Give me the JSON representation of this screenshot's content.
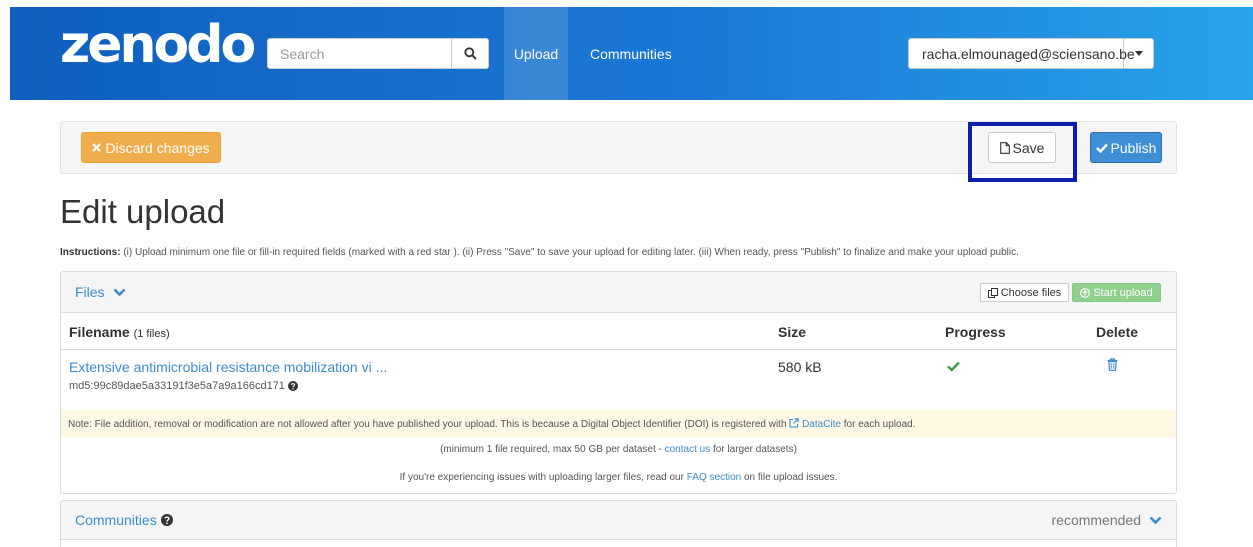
{
  "header": {
    "logo_text": "zenodo",
    "search_placeholder": "Search",
    "nav_upload": "Upload",
    "nav_communities": "Communities",
    "user_email": "racha.elmounaged@sciensano.be"
  },
  "actions": {
    "discard_label": "Discard changes",
    "save_label": "Save",
    "publish_label": "Publish"
  },
  "page": {
    "title": "Edit upload",
    "instructions_label": "Instructions:",
    "instructions_text": " (i) Upload minimum one file or fill-in required fields (marked with a red star ). (ii) Press \"Save\" to save your upload for editing later. (iii) When ready, press \"Publish\" to finalize and make your upload public."
  },
  "files": {
    "panel_title": "Files",
    "choose_label": "Choose files",
    "start_label": "Start upload",
    "col_filename": "Filename",
    "col_filename_count": "(1 files)",
    "col_size": "Size",
    "col_progress": "Progress",
    "col_delete": "Delete",
    "rows": [
      {
        "name": "Extensive antimicrobial resistance mobilization vi ...",
        "md5": "md5:99c89dae5a33191f3e5a7a9a166cd171",
        "size": "580 kB"
      }
    ],
    "note_prefix": "Note: File addition, removal or modification are not allowed after you have published your upload. This is because a Digital Object Identifier (DOI) is registered with ",
    "note_link": "DataCite",
    "note_suffix": " for each upload.",
    "limit_prefix": "(minimum 1 file required, max 50 GB per dataset - ",
    "limit_link": "contact us",
    "limit_suffix": " for larger datasets)",
    "faq_prefix": "If you're experiencing issues with uploading larger files, read our ",
    "faq_link": "FAQ section",
    "faq_suffix": " on file upload issues."
  },
  "communities": {
    "panel_title": "Communities",
    "recommended": "recommended"
  },
  "colors": {
    "navbar_start": "#0f5fbd",
    "navbar_end": "#27a3ea",
    "discard": "#f0ad4e",
    "publish": "#3f8fd6",
    "highlight": "#0b1fa8",
    "link": "#3c8dce",
    "success": "#3c9a3c"
  }
}
